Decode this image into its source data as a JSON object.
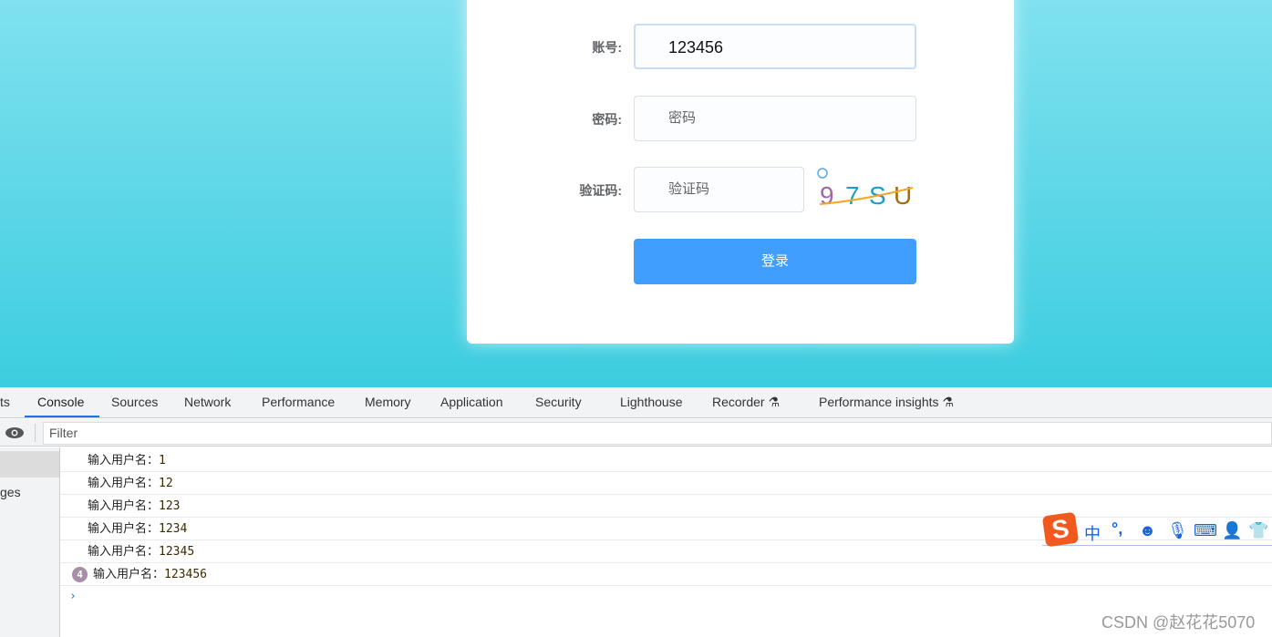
{
  "login": {
    "account_label": "账号:",
    "account_value": "123456",
    "password_label": "密码:",
    "password_placeholder": "密码",
    "captcha_label": "验证码:",
    "captcha_placeholder": "验证码",
    "captcha_chars": [
      "9",
      "7",
      "S",
      "U"
    ],
    "login_button": "登录"
  },
  "devtools": {
    "tabs": [
      "ts",
      "Console",
      "Sources",
      "Network",
      "Performance",
      "Memory",
      "Application",
      "Security",
      "Lighthouse",
      "Recorder",
      "Performance insights"
    ],
    "active_tab": "Console",
    "filter_placeholder": "Filter",
    "sidebar_text": "ges",
    "logs": [
      {
        "prefix": "输入用户名：",
        "value": "1"
      },
      {
        "prefix": "输入用户名：",
        "value": "12"
      },
      {
        "prefix": "输入用户名：",
        "value": "123"
      },
      {
        "prefix": "输入用户名：",
        "value": "1234"
      },
      {
        "prefix": "输入用户名：",
        "value": "12345"
      },
      {
        "prefix": "输入用户名：",
        "value": "123456",
        "count": "4"
      }
    ]
  },
  "ime": {
    "logo": "S",
    "lang": "中",
    "punct": "°,"
  },
  "watermark": "CSDN @赵花花5070",
  "colors": {
    "primary": "#409eff",
    "bg_top": "#80e1ef",
    "bg_bottom": "#3ccde0"
  }
}
